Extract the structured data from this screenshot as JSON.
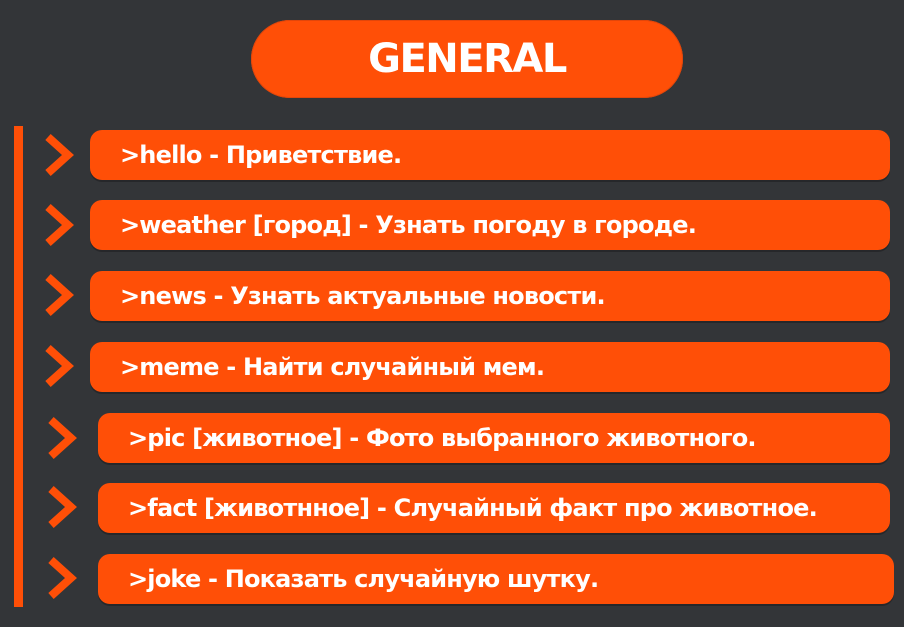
{
  "colors": {
    "background": "#333538",
    "accent": "#ff4f07",
    "text": "#ffffff"
  },
  "header": {
    "title": "GENERAL"
  },
  "commands": [
    {
      "text": ">hello - Приветствие."
    },
    {
      "text": ">weather [город] - Узнать погоду в городе."
    },
    {
      "text": ">news - Узнать актуальные новости."
    },
    {
      "text": ">meme - Найти случайный мем."
    },
    {
      "text": ">pic [животное] - Фото выбранного животного."
    },
    {
      "text": ">fact [животнное] - Случайный факт про животное."
    },
    {
      "text": ">joke - Показать случайную шутку."
    }
  ],
  "icons": {
    "bullet": "chevron-right-icon"
  }
}
